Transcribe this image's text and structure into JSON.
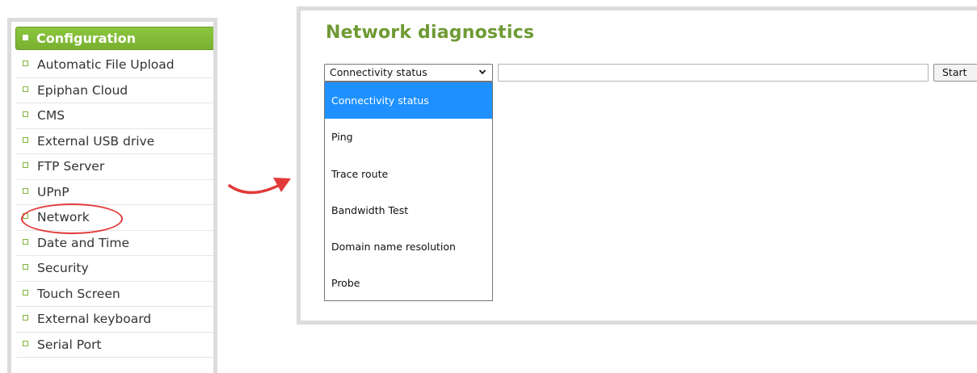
{
  "sidebar": {
    "header": "Configuration",
    "items": [
      {
        "label": "Automatic File Upload"
      },
      {
        "label": "Epiphan Cloud"
      },
      {
        "label": "CMS"
      },
      {
        "label": "External USB drive"
      },
      {
        "label": "FTP Server"
      },
      {
        "label": "UPnP"
      },
      {
        "label": "Network"
      },
      {
        "label": "Date and Time"
      },
      {
        "label": "Security"
      },
      {
        "label": "Touch Screen"
      },
      {
        "label": "External keyboard"
      },
      {
        "label": "Serial Port"
      }
    ],
    "highlighted_item": "Network"
  },
  "annotation": {
    "circle_color": "#e23a3a",
    "arrow_color": "#e23a3a"
  },
  "main": {
    "title": "Network diagnostics",
    "title_color": "#6f9a34",
    "select": {
      "selected_value": "Connectivity status",
      "options": [
        "Connectivity status",
        "Ping",
        "Trace route",
        "Bandwidth Test",
        "Domain name resolution",
        "Probe"
      ]
    },
    "target_input": {
      "value": "",
      "placeholder": ""
    },
    "start_button": "Start"
  },
  "colors": {
    "accent_green": "#8cc63f",
    "selection_blue": "#1e90ff"
  }
}
